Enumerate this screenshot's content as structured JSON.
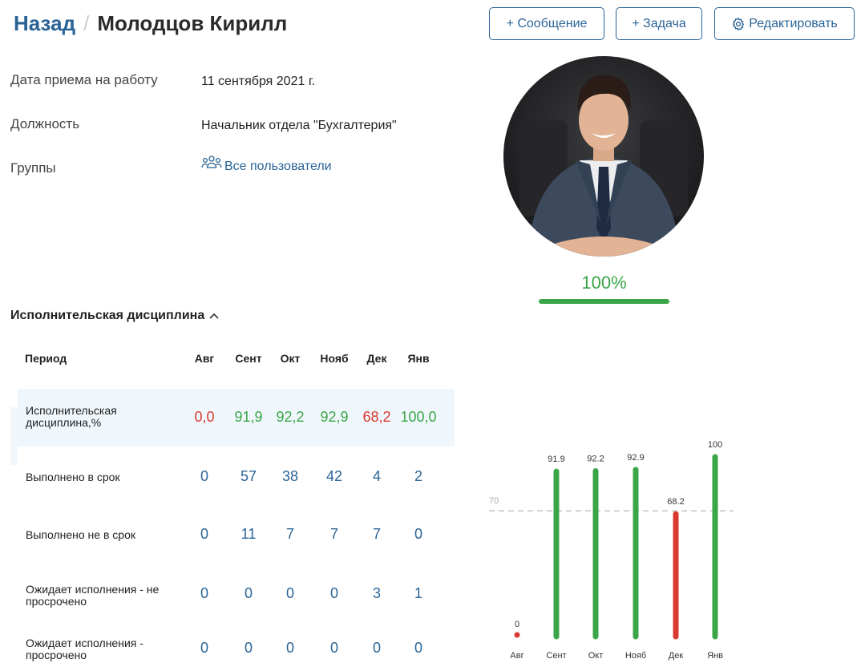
{
  "header": {
    "back_label": "Назад",
    "separator": "/",
    "employee_name": "Молодцов Кирилл",
    "buttons": {
      "message": "+ Сообщение",
      "task": "+ Задача",
      "edit": "Редактировать"
    }
  },
  "profile": {
    "fields": [
      {
        "label": "Дата приема на работу",
        "value": "11 сентября 2021 г."
      },
      {
        "label": "Должность",
        "value": "Начальник отдела \"Бухгалтерия\""
      },
      {
        "label": "Группы",
        "value": "Все пользователи",
        "icon": "users-icon"
      }
    ],
    "discipline_percent": "100%",
    "discipline_fill": 1.0,
    "percent_color": "#3aa648"
  },
  "discipline": {
    "section_title": "Исполнительская дисциплина",
    "period_header": "Период",
    "months": [
      "Авг",
      "Сент",
      "Окт",
      "Нояб",
      "Дек",
      "Янв"
    ],
    "rows": [
      {
        "label": "Исполнительская дисциплина,%",
        "values": [
          "0,0",
          "91,9",
          "92,2",
          "92,9",
          "68,2",
          "100,0"
        ],
        "statuses": [
          "bad",
          "good",
          "good",
          "good",
          "bad",
          "good"
        ]
      },
      {
        "label": "Выполнено в срок",
        "values": [
          "0",
          "57",
          "38",
          "42",
          "4",
          "2"
        ]
      },
      {
        "label": "Выполнено не в срок",
        "values": [
          "0",
          "11",
          "7",
          "7",
          "7",
          "0"
        ]
      },
      {
        "label": "Ожидает исполнения - не просрочено",
        "values": [
          "0",
          "0",
          "0",
          "0",
          "3",
          "1"
        ]
      },
      {
        "label": "Ожидает исполнения - просрочено",
        "values": [
          "0",
          "0",
          "0",
          "0",
          "0",
          "0"
        ]
      }
    ]
  },
  "colors": {
    "accent": "#2a6497",
    "good": "#3aa648",
    "bad": "#d93a30",
    "highlight_row": "#f0f7fc"
  },
  "chart_data": {
    "type": "bar",
    "categories": [
      "Авг",
      "Сент",
      "Окт",
      "Нояб",
      "Дек",
      "Янв"
    ],
    "values": [
      0,
      91.9,
      92.2,
      92.9,
      68.2,
      100
    ],
    "data_labels": [
      "0",
      "91.9",
      "92.2",
      "92.9",
      "68.2",
      "100"
    ],
    "threshold": 70,
    "threshold_label": "70",
    "ylim": [
      0,
      100
    ],
    "good_color": "#3aa648",
    "bad_color": "#d93a30"
  }
}
